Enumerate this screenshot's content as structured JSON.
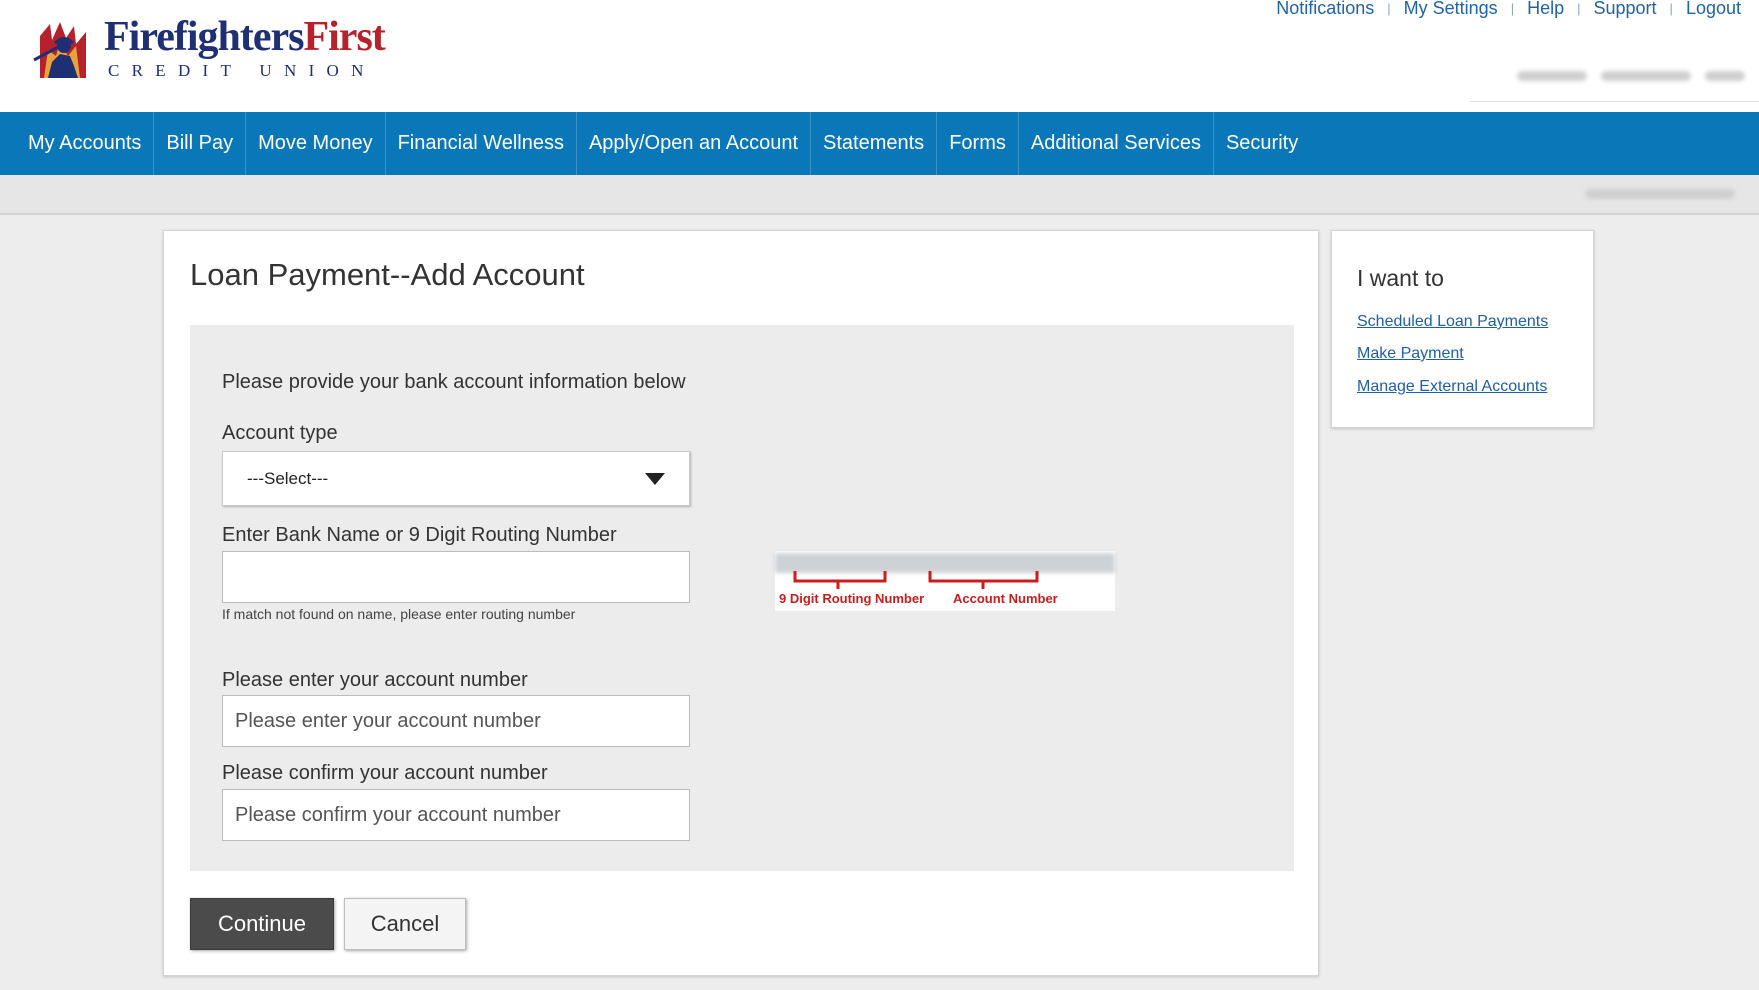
{
  "brand": {
    "name_part1": "Firefighters",
    "name_part2": "First",
    "subtitle": "CREDIT UNION"
  },
  "colors": {
    "nav_bg": "#0a77b8",
    "brand_navy": "#1f2f73",
    "brand_red": "#b7212b",
    "link_blue": "#1f63a8",
    "primary_button": "#4b4b4b",
    "routing_caption_red": "#cc1d1d"
  },
  "util_links": {
    "notifications": "Notifications",
    "my_settings": "My Settings",
    "help": "Help",
    "support": "Support",
    "logout": "Logout"
  },
  "nav": {
    "my_accounts": "My Accounts",
    "bill_pay": "Bill Pay",
    "move_money": "Move Money",
    "financial_wellness": "Financial Wellness",
    "apply_open": "Apply/Open an Account",
    "statements": "Statements",
    "forms": "Forms",
    "additional_services": "Additional Services",
    "security": "Security"
  },
  "page": {
    "title": "Loan Payment--Add Account"
  },
  "form": {
    "intro": "Please provide your bank account information below",
    "account_type_label": "Account type",
    "account_type_selected": "---Select---",
    "bank_label": "Enter Bank Name or 9 Digit Routing Number",
    "bank_value": "",
    "bank_hint": "If match not found on name, please enter routing number",
    "account_label": "Please enter your account number",
    "account_placeholder": "Please enter your account number",
    "confirm_label": "Please confirm your account number",
    "confirm_placeholder": "Please confirm your account number",
    "check_routing_caption": "9 Digit Routing Number",
    "check_account_caption": "Account Number"
  },
  "actions": {
    "continue": "Continue",
    "cancel": "Cancel"
  },
  "sidebar": {
    "title": "I want to",
    "links": [
      "Scheduled Loan Payments",
      "Make Payment",
      "Manage External Accounts"
    ]
  }
}
